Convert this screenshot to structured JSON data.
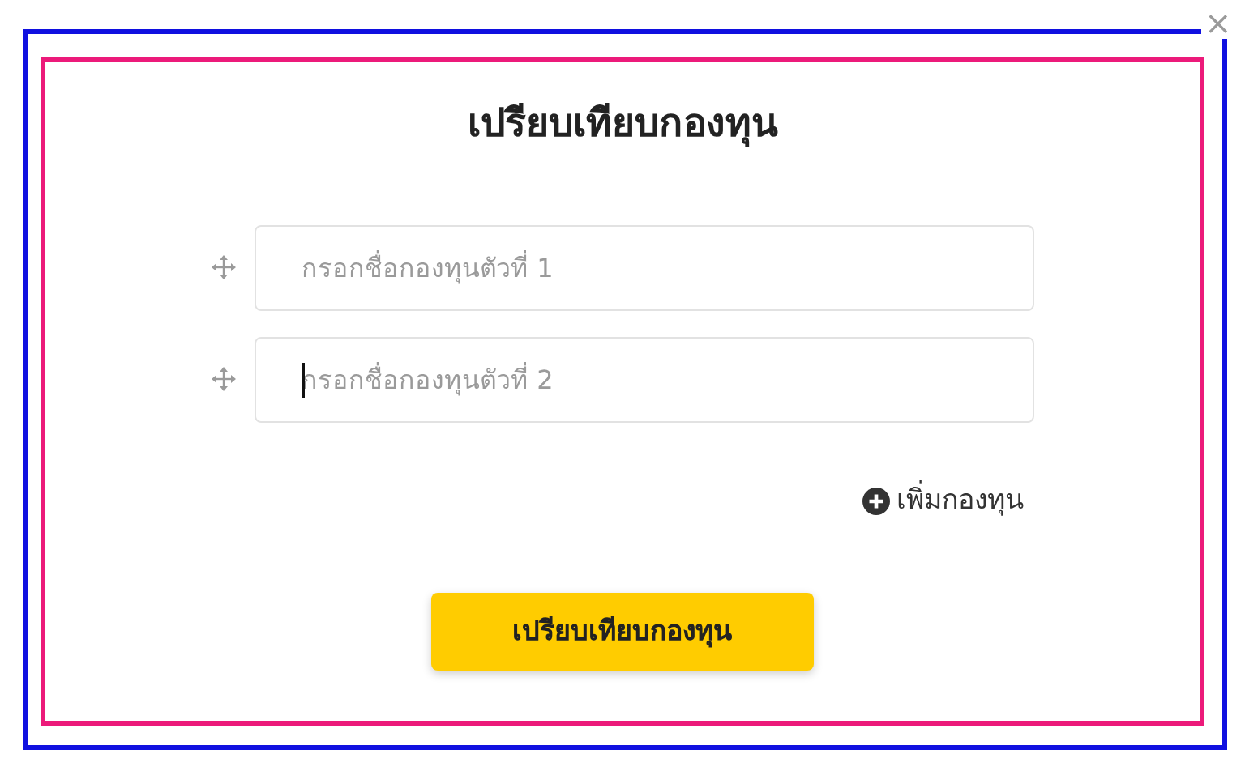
{
  "dialog": {
    "close": "×",
    "title": "เปรียบเทียบกองทุน"
  },
  "fund_inputs": [
    {
      "placeholder": "กรอกชื่อกองทุนตัวที่ 1",
      "focused": false
    },
    {
      "placeholder": "กรอกชื่อกองทุนตัวที่ 2",
      "focused": true
    }
  ],
  "add_fund": "เพิ่มกองทุน",
  "submit_button": "เปรียบเทียบกองทุน"
}
